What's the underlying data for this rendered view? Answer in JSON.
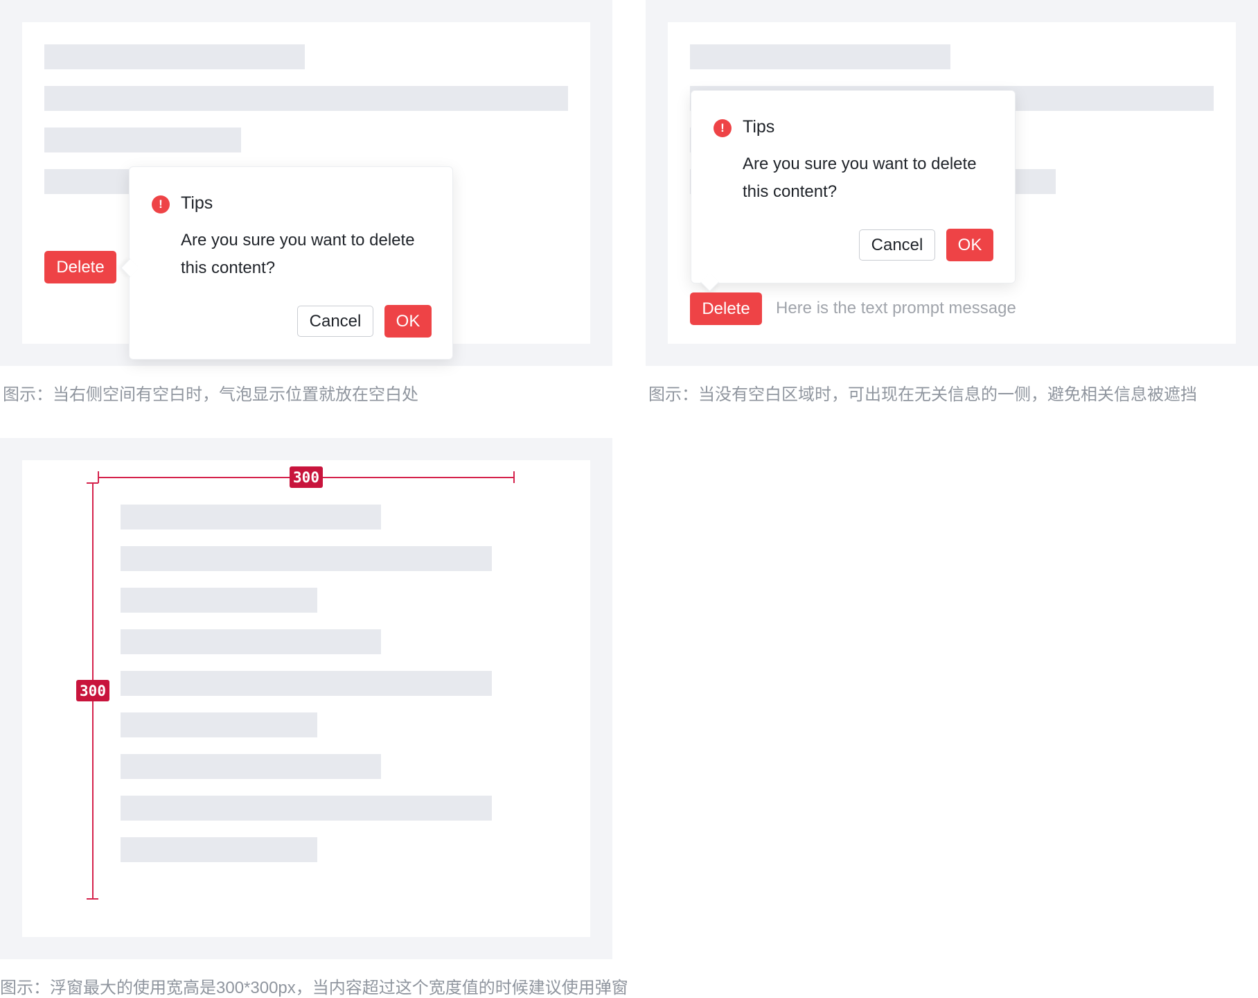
{
  "panel1": {
    "delete_label": "Delete",
    "popover": {
      "title": "Tips",
      "message_line1": "Are you sure you want to delete",
      "message_line2": "this content?",
      "cancel_label": "Cancel",
      "ok_label": "OK",
      "icon": "exclamation-circle-icon"
    },
    "caption": "图示：当右侧空间有空白时，气泡显示位置就放在空白处"
  },
  "panel2": {
    "delete_label": "Delete",
    "hint": "Here is the text prompt message",
    "popover": {
      "title": "Tips",
      "message_line1": "Are you sure you want to delete",
      "message_line2": "this content?",
      "cancel_label": "Cancel",
      "ok_label": "OK",
      "icon": "exclamation-circle-icon"
    },
    "caption": "图示：当没有空白区域时，可出现在无关信息的一侧，避免相关信息被遮挡"
  },
  "panel3": {
    "width_value": "300",
    "height_value": "300",
    "caption": "图示：浮窗最大的使用宽高是300*300px，当内容超过这个宽度值的时候建议使用弹窗"
  },
  "colors": {
    "danger": "#ee4346",
    "frame_bg": "#f3f4f7",
    "skeleton": "#e7e9ee",
    "dimension": "#c8143c",
    "caption": "#8f959e"
  }
}
